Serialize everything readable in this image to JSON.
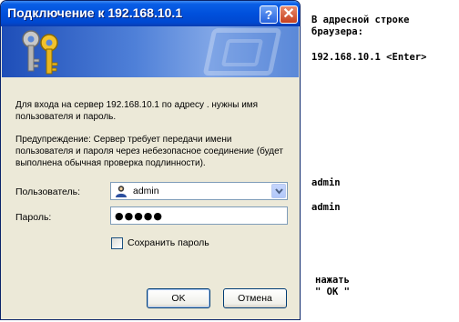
{
  "dialog": {
    "title": "Подключение к 192.168.10.1",
    "help_button": "?",
    "close_button": "✕",
    "message": "Для входа на сервер 192.168.10.1 по адресу . нужны имя пользователя и пароль.",
    "warning": "Предупреждение: Сервер требует передачи имени пользователя и пароля через небезопасное соединение (будет выполнена обычная проверка подлинности).",
    "username_label": "Пользователь:",
    "username_value": "admin",
    "password_label": "Пароль:",
    "password_value": "●●●●●",
    "remember_label": "Сохранить пароль",
    "remember_checked": false,
    "ok_label": "OK",
    "cancel_label": "Отмена"
  },
  "instructions": {
    "address_hint_line1": "В адресной строке",
    "address_hint_line2": "браузера:",
    "address_value": "192.168.10.1 <Enter>",
    "username_hint": "admin",
    "password_hint": "admin",
    "press_line1": "нажать",
    "press_line2": "\" OK \""
  },
  "icons": {
    "banner": "keys-icon",
    "user": "user-icon",
    "dropdown": "chevron-down-icon"
  },
  "colors": {
    "titlebar": "#0050dc",
    "dialog_bg": "#ece9d8",
    "banner": "#4f80d8"
  }
}
